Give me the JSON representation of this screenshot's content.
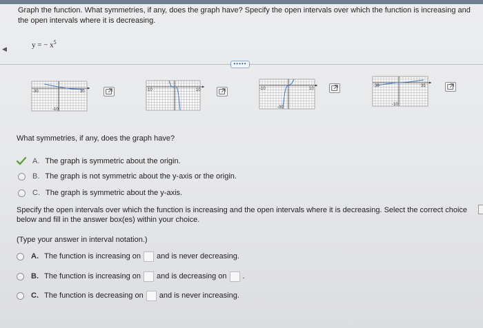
{
  "question": {
    "text": "Graph the function. What symmetries, if any, does the graph have? Specify the open intervals over which the function is increasing and the open intervals where it is decreasing.",
    "equation_lhs": "y = − x",
    "equation_exp": "5"
  },
  "toolbar": {
    "more_label": "•••••"
  },
  "graphs": [
    {
      "left_tick": "-30",
      "right_tick": "30",
      "bottom_tick": "-10"
    },
    {
      "left_tick": "-10",
      "right_tick": "10",
      "bottom_tick": ""
    },
    {
      "left_tick": "-10",
      "right_tick": "10",
      "bottom_tick": "-30"
    },
    {
      "left_tick": "-30",
      "right_tick": "35",
      "bottom_tick": "-10"
    }
  ],
  "symmetry": {
    "prompt": "What symmetries, if any, does the graph have?",
    "options": [
      {
        "letter": "A.",
        "text": "The graph is symmetric about the origin.",
        "selected": true
      },
      {
        "letter": "B.",
        "text": "The graph is not symmetric about the y-axis or the origin.",
        "selected": false
      },
      {
        "letter": "C.",
        "text": "The graph is symmetric about the y-axis.",
        "selected": false
      }
    ]
  },
  "intervals": {
    "prompt": "Specify the open intervals over which the function is increasing and the open intervals where it is decreasing. Select the correct choice below and fill in the answer box(es) within your choice.",
    "notation": "(Type your answer in interval notation.)",
    "options": [
      {
        "letter": "A.",
        "pre": "The function is increasing on",
        "post": "and is never decreasing."
      },
      {
        "letter": "B.",
        "pre": "The function is increasing on",
        "mid": "and is decreasing on",
        "post": "."
      },
      {
        "letter": "C.",
        "pre": "The function is decreasing on",
        "post": "and is never increasing."
      }
    ]
  },
  "colors": {
    "accent": "#3b6db3",
    "check": "#5f9e3a",
    "curve": "#3e78c4"
  }
}
